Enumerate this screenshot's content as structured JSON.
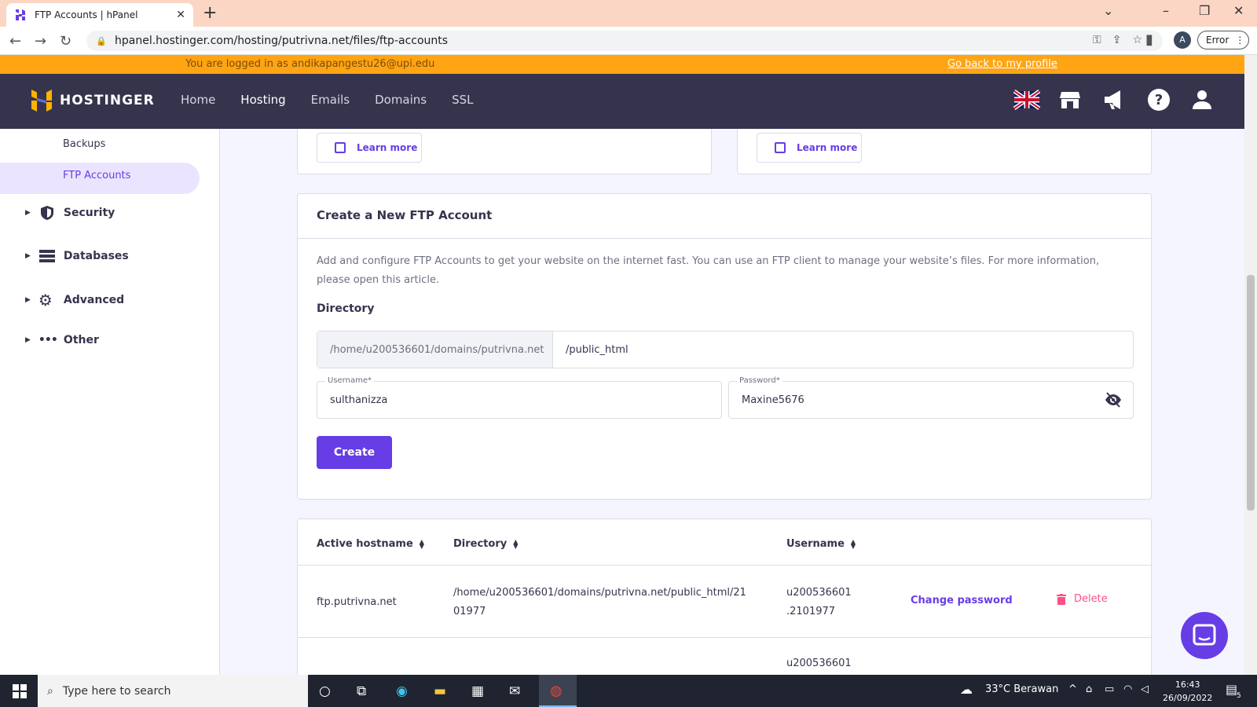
{
  "browser": {
    "tab_title": "FTP Accounts | hPanel",
    "url": "hpanel.hostinger.com/hosting/putrivna.net/files/ftp-accounts",
    "profile_letter": "A",
    "error_label": "Error"
  },
  "notice": {
    "logged_in": "You are logged in as andikapangestu26@upi.edu",
    "back_link": "Go back to my profile"
  },
  "header": {
    "brand": "HOSTINGER",
    "menu": [
      {
        "label": "Home"
      },
      {
        "label": "Hosting"
      },
      {
        "label": "Emails"
      },
      {
        "label": "Domains"
      },
      {
        "label": "SSL"
      }
    ]
  },
  "sidebar": {
    "backups": "Backups",
    "ftp_accounts": "FTP Accounts",
    "items": [
      {
        "label": "Security"
      },
      {
        "label": "Databases"
      },
      {
        "label": "Advanced"
      },
      {
        "label": "Other"
      }
    ]
  },
  "learn_more": "Learn more",
  "create_card": {
    "title": "Create a New FTP Account",
    "description": "Add and configure FTP Accounts to get your website on the internet fast. You can use an FTP client to manage your website’s files. For more information, please open this article.",
    "directory_label": "Directory",
    "directory_prefix": "/home/u200536601/domains/putrivna.net",
    "directory_value": "/public_html",
    "username_label": "Username*",
    "username_value": "sulthanizza",
    "password_label": "Password*",
    "password_value": "Maxine5676",
    "create_button": "Create"
  },
  "table": {
    "headers": {
      "hostname": "Active hostname",
      "directory": "Directory",
      "username": "Username"
    },
    "rows": [
      {
        "hostname": "ftp.putrivna.net",
        "directory_line1": "/home/u200536601/domains/putrivna.net/public_html/21",
        "directory_line2": "01977",
        "username_line1": "u200536601",
        "username_line2": ".2101977",
        "change_password": "Change password",
        "delete": "Delete"
      }
    ],
    "partial_next_username": "u200536601"
  },
  "taskbar": {
    "search_placeholder": "Type here to search",
    "weather": "33°C  Berawan",
    "time": "16:43",
    "date": "26/09/2022",
    "notif_count": "5"
  },
  "colors": {
    "brand_purple": "#673de6",
    "header_bg": "#36344d",
    "notice_bg": "#ffa412",
    "delete_pink": "#fc5185"
  }
}
